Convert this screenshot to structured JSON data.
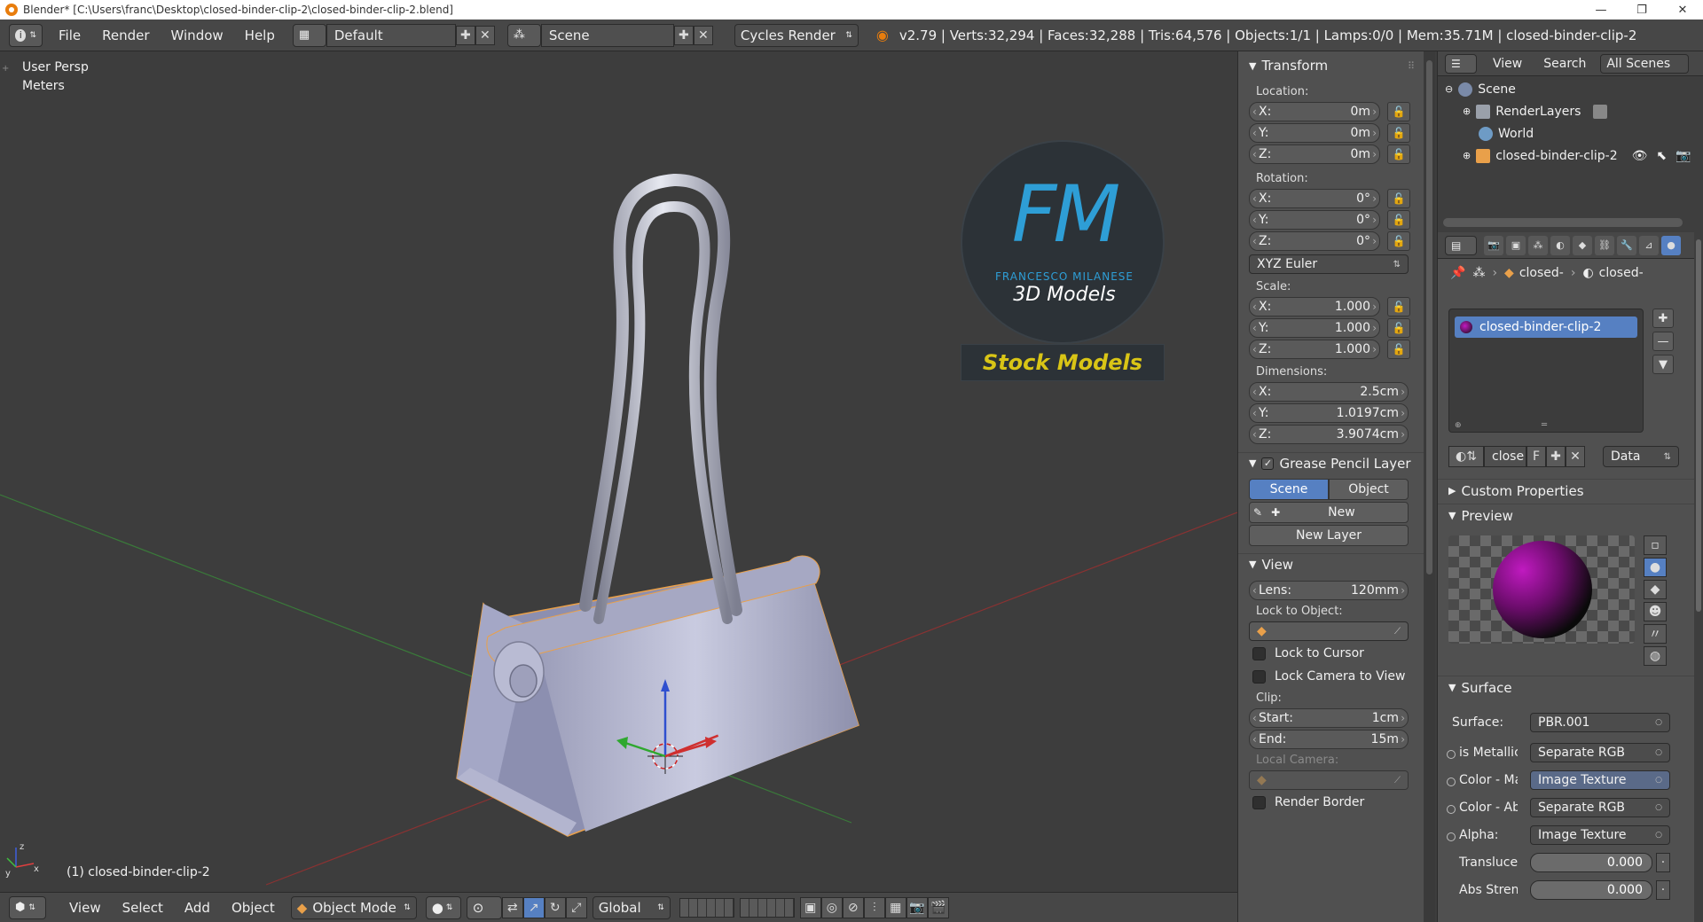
{
  "window": {
    "title": "Blender* [C:\\Users\\franc\\Desktop\\closed-binder-clip-2\\closed-binder-clip-2.blend]",
    "minimize": "—",
    "maximize": "❐",
    "close": "✕"
  },
  "info_header": {
    "menus": [
      "File",
      "Render",
      "Window",
      "Help"
    ],
    "layout": "Default",
    "scene": "Scene",
    "engine": "Cycles Render",
    "stats": "v2.79 | Verts:32,294 | Faces:32,288 | Tris:64,576 | Objects:1/1 | Lamps:0/0 | Mem:35.71M | closed-binder-clip-2"
  },
  "viewport": {
    "view_name": "User Persp",
    "units": "Meters",
    "object_label": "(1) closed-binder-clip-2",
    "watermark": {
      "logo_text": "FM",
      "brand": "FRANCESCO MILANESE",
      "subtitle": "3D Models",
      "banner": "Stock Models"
    }
  },
  "viewport_header": {
    "menus": [
      "View",
      "Select",
      "Add",
      "Object"
    ],
    "mode": "Object Mode",
    "orientation": "Global"
  },
  "npanel": {
    "transform_title": "Transform",
    "location_label": "Location:",
    "location": [
      {
        "axis": "X:",
        "value": "0m"
      },
      {
        "axis": "Y:",
        "value": "0m"
      },
      {
        "axis": "Z:",
        "value": "0m"
      }
    ],
    "rotation_label": "Rotation:",
    "rotation": [
      {
        "axis": "X:",
        "value": "0°"
      },
      {
        "axis": "Y:",
        "value": "0°"
      },
      {
        "axis": "Z:",
        "value": "0°"
      }
    ],
    "rotation_mode": "XYZ Euler",
    "scale_label": "Scale:",
    "scale": [
      {
        "axis": "X:",
        "value": "1.000"
      },
      {
        "axis": "Y:",
        "value": "1.000"
      },
      {
        "axis": "Z:",
        "value": "1.000"
      }
    ],
    "dimensions_label": "Dimensions:",
    "dimensions": [
      {
        "axis": "X:",
        "value": "2.5cm"
      },
      {
        "axis": "Y:",
        "value": "1.0197cm"
      },
      {
        "axis": "Z:",
        "value": "3.9074cm"
      }
    ],
    "grease_title": "Grease Pencil Layer",
    "grease_scene": "Scene",
    "grease_object": "Object",
    "grease_new": "New",
    "grease_new_layer": "New Layer",
    "view_title": "View",
    "lens_label": "Lens:",
    "lens_value": "120mm",
    "lock_object_label": "Lock to Object:",
    "lock_cursor": "Lock to Cursor",
    "lock_camera": "Lock Camera to View",
    "clip_label": "Clip:",
    "clip_start_label": "Start:",
    "clip_start": "1cm",
    "clip_end_label": "End:",
    "clip_end": "15m",
    "local_camera": "Local Camera:",
    "render_border": "Render Border"
  },
  "outliner": {
    "view": "View",
    "search": "Search",
    "filter": "All Scenes",
    "rows": [
      "Scene",
      "RenderLayers",
      "World",
      "closed-binder-clip-2"
    ]
  },
  "properties": {
    "crumb_1": "closed-",
    "crumb_2": "closed-",
    "material_slot": "closed-binder-clip-2",
    "mat_name_short": "close",
    "mat_fake": "F",
    "data_mode": "Data",
    "custom_props": "Custom Properties",
    "preview": "Preview",
    "surface_title": "Surface",
    "surface_label": "Surface:",
    "surface_value": "PBR.001",
    "inputs": [
      {
        "label": "is Metallic",
        "value": "Separate RGB",
        "active": false
      },
      {
        "label": "Color - Ma",
        "value": "Image Texture",
        "active": true
      },
      {
        "label": "Color - Ab",
        "value": "Separate RGB",
        "active": false
      },
      {
        "label": "Alpha:",
        "value": "Image Texture",
        "active": false
      }
    ],
    "sliders": [
      {
        "label": "Transluce",
        "value": "0.000"
      },
      {
        "label": "Abs Stren",
        "value": "0.000"
      }
    ]
  },
  "colors": {
    "accent": "#5680c2",
    "bg": "#3d3d3d",
    "panel": "#505050",
    "object_outline": "#e9a04a",
    "banner_text": "#d9c516"
  }
}
